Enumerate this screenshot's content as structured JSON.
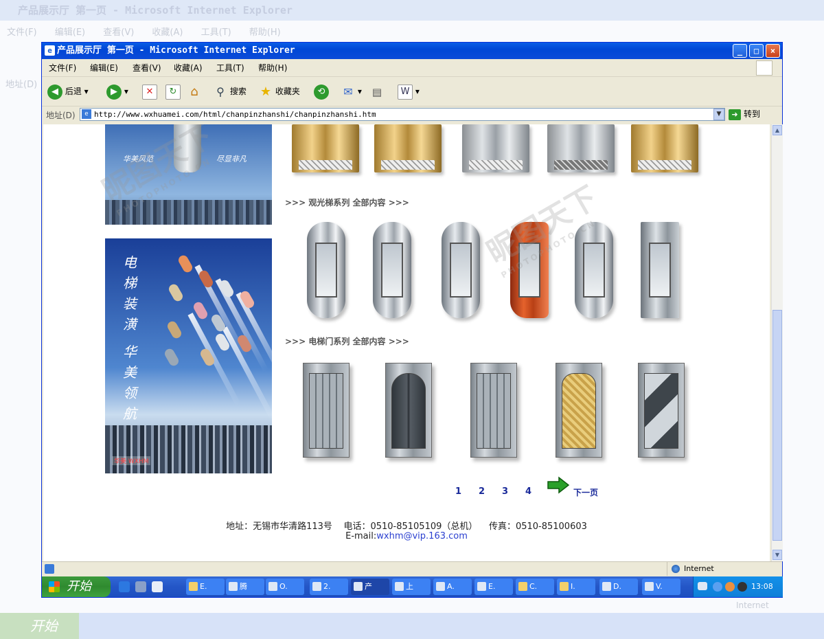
{
  "background_window": {
    "title": "产品展示厅 第一页 - Microsoft Internet Explorer",
    "menu": "文件(F) 编辑(E) 查看(V) 收藏(A) 工具(T) 帮助(H)",
    "address_label": "地址(D)",
    "start_label": "开始",
    "status_zone": "Internet"
  },
  "window": {
    "title": "产品展示厅 第一页 - Microsoft Internet Explorer",
    "controls": {
      "minimize": "_",
      "maximize": "□",
      "close": "×"
    }
  },
  "menu": [
    "文件(F)",
    "编辑(E)",
    "查看(V)",
    "收藏(A)",
    "工具(T)",
    "帮助(H)"
  ],
  "toolbar": {
    "back": "后退",
    "search": "搜索",
    "favorites": "收藏夹"
  },
  "address": {
    "label": "地址(D)",
    "url": "http://www.wxhuamei.com/html/chanpinzhanshi/chanpinzhanshi.htm",
    "go": "转到"
  },
  "page": {
    "banner1_left": "华美风范",
    "banner1_right": "尽显非凡",
    "banner2_lines": [
      "电",
      "梯",
      "装",
      "潢"
    ],
    "banner2_lines2": [
      "华",
      "美",
      "领",
      "航"
    ],
    "banner2_brand": "华美 WXHM",
    "sections": [
      {
        "title": ">>> 观光梯系列  全部内容  >>>"
      },
      {
        "title": ">>> 电梯门系列  全部内容  >>>"
      }
    ],
    "pager": {
      "pages": [
        "1",
        "2",
        "3",
        "4"
      ],
      "next": "下一页"
    },
    "footer": {
      "address": "地址：无锡市华清路113号",
      "phone": "电话：0510-85105109（总机）",
      "fax": "传真：0510-85100603",
      "email_label": "E-mail:",
      "email": "wxhm@vip.163.com"
    },
    "watermark": "昵图天下",
    "watermark_sub": "PHOTOPHOTO.CN"
  },
  "status": {
    "zone": "Internet"
  },
  "taskbar": {
    "start": "开始",
    "tasks": [
      "E.",
      "腾",
      "O.",
      "2.",
      "产",
      "上",
      "A.",
      "E.",
      "C.",
      "I.",
      "D.",
      "V."
    ],
    "clock": "13:08"
  }
}
